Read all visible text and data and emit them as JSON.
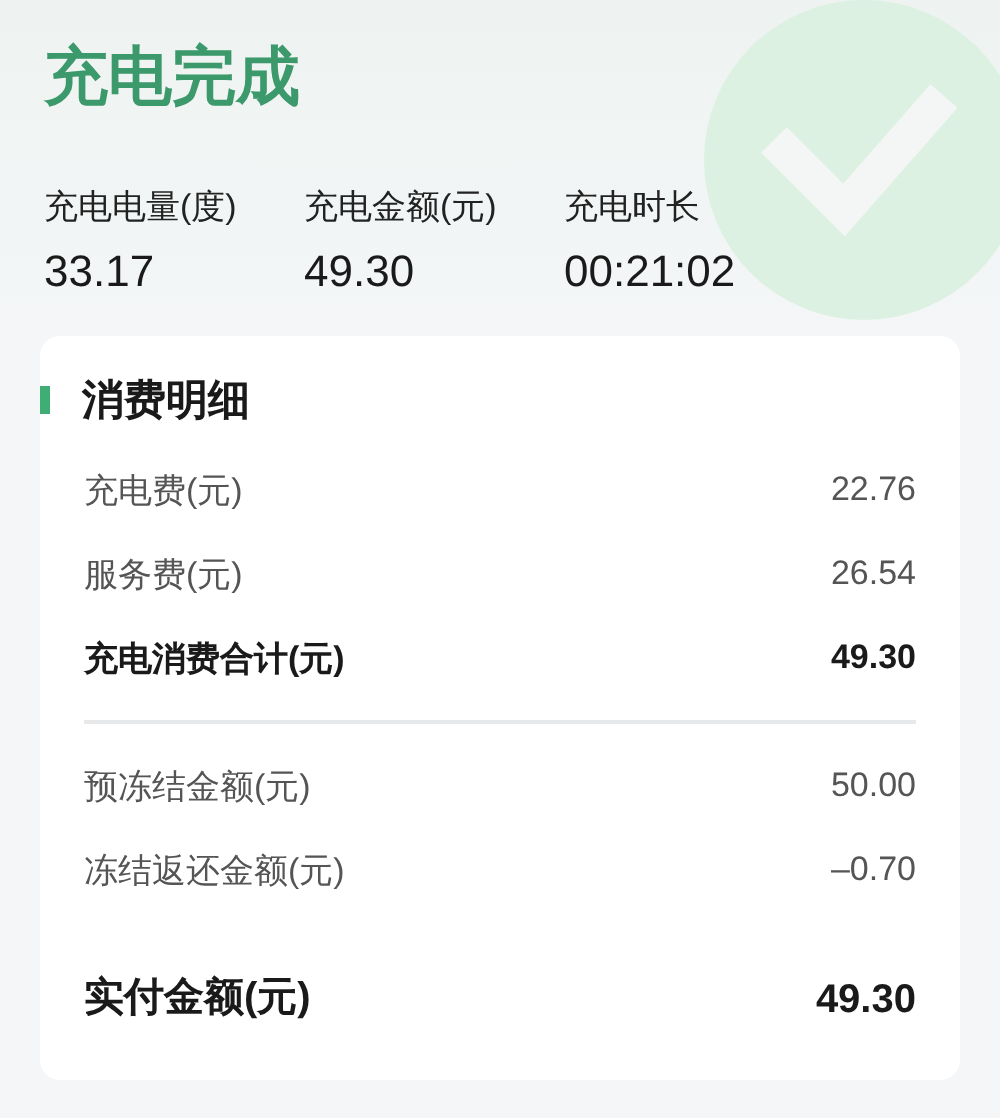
{
  "title": "充电完成",
  "stats": [
    {
      "label": "充电电量(度)",
      "value": "33.17"
    },
    {
      "label": "充电金额(元)",
      "value": "49.30"
    },
    {
      "label": "充电时长",
      "value": "00:21:02"
    }
  ],
  "details": {
    "title": "消费明细",
    "sections": [
      {
        "rows": [
          {
            "label": "充电费(元)",
            "value": "22.76",
            "kind": "item"
          },
          {
            "label": "服务费(元)",
            "value": "26.54",
            "kind": "item"
          },
          {
            "label": "充电消费合计(元)",
            "value": "49.30",
            "kind": "subtotal"
          }
        ]
      },
      {
        "rows": [
          {
            "label": "预冻结金额(元)",
            "value": "50.00",
            "kind": "item"
          },
          {
            "label": "冻结返还金额(元)",
            "value": "–0.70",
            "kind": "item"
          },
          {
            "label": "实付金额(元)",
            "value": "49.30",
            "kind": "total"
          }
        ]
      }
    ]
  }
}
